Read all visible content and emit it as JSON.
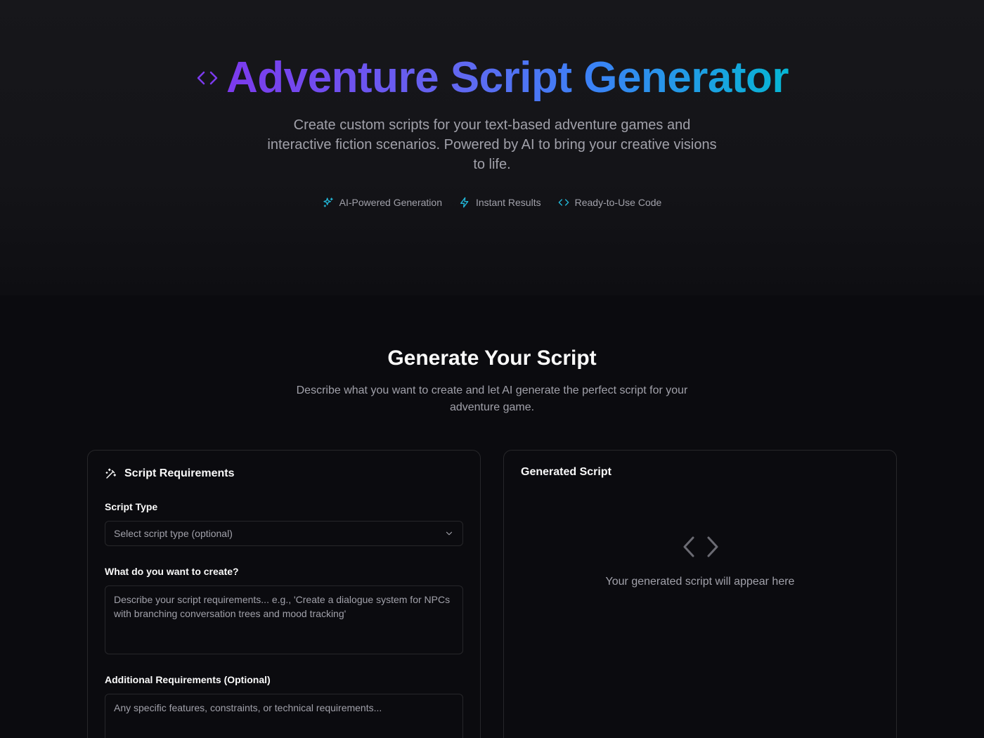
{
  "hero": {
    "title": "Adventure Script Generator",
    "subtitle": "Create custom scripts for your text-based adventure games and interactive fiction scenarios. Powered by AI to bring your creative visions to life.",
    "features": [
      {
        "icon": "sparkles-icon",
        "label": "AI-Powered Generation"
      },
      {
        "icon": "lightning-icon",
        "label": "Instant Results"
      },
      {
        "icon": "code-icon",
        "label": "Ready-to-Use Code"
      }
    ]
  },
  "section": {
    "title": "Generate Your Script",
    "subtitle": "Describe what you want to create and let AI generate the perfect script for your adventure game."
  },
  "requirements": {
    "title": "Script Requirements",
    "script_type_label": "Script Type",
    "script_type_value": "Select script type (optional)",
    "create_label": "What do you want to create?",
    "create_placeholder": "Describe your script requirements... e.g., 'Create a dialogue system for NPCs with branching conversation trees and mood tracking'",
    "additional_label": "Additional Requirements (Optional)",
    "additional_placeholder": "Any specific features, constraints, or technical requirements..."
  },
  "output": {
    "title": "Generated Script",
    "empty_text": "Your generated script will appear here"
  },
  "colors": {
    "background": "#0b0b0f",
    "gradient_start": "#7c3aed",
    "gradient_end": "#06b6d4",
    "accent_cyan": "#22b8d9",
    "border": "#27272a"
  }
}
